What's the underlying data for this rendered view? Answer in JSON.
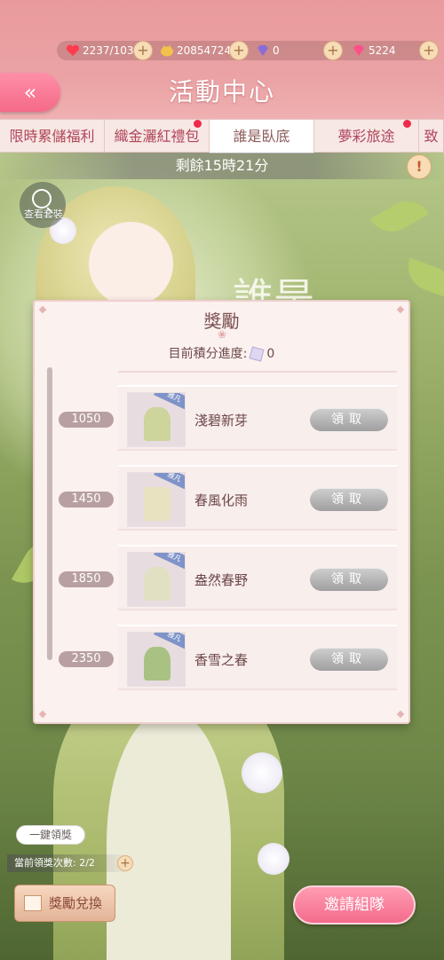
{
  "resources": [
    {
      "name": "stamina",
      "icon": "heart-icon",
      "value": "2237/103"
    },
    {
      "name": "gold",
      "icon": "coin-icon",
      "value": "20854724"
    },
    {
      "name": "diamond",
      "icon": "diamond-icon",
      "value": "0"
    },
    {
      "name": "gem",
      "icon": "pink-gem-icon",
      "value": "5224"
    }
  ],
  "header": {
    "title": "活動中心",
    "back_symbol": "«"
  },
  "tabs": [
    {
      "label": "限時累儲福利",
      "active": false,
      "dot": false
    },
    {
      "label": "織金灑紅禮包",
      "active": false,
      "dot": true
    },
    {
      "label": "誰是臥底",
      "active": true,
      "dot": false
    },
    {
      "label": "夢彩旅途",
      "active": false,
      "dot": true
    },
    {
      "label": "致",
      "active": false,
      "dot": false
    }
  ],
  "timer": "剩餘15時21分",
  "view_set_label": "查看套裝",
  "background_title": "誰是",
  "panel": {
    "title": "獎勵",
    "progress_label": "目前積分進度:",
    "progress_value": "0",
    "rows": [
      {
        "score": "1050",
        "name": "淺碧新芽",
        "claim": "領取",
        "badge": "雅凡"
      },
      {
        "score": "1450",
        "name": "春風化雨",
        "claim": "領取",
        "badge": "雅凡"
      },
      {
        "score": "1850",
        "name": "盎然春野",
        "claim": "領取",
        "badge": "雅凡"
      },
      {
        "score": "2350",
        "name": "香雪之春",
        "claim": "領取",
        "badge": "雅凡"
      }
    ]
  },
  "bottom": {
    "one_key_claim": "一鍵領獎",
    "claim_count": "當前領獎次數: 2/2",
    "exchange": "獎勵兌換",
    "invite": "邀請組隊"
  },
  "colors": {
    "accent": "#f46b8c",
    "tab_text": "#b0455a",
    "claim_disabled": "#a8a8a8"
  }
}
